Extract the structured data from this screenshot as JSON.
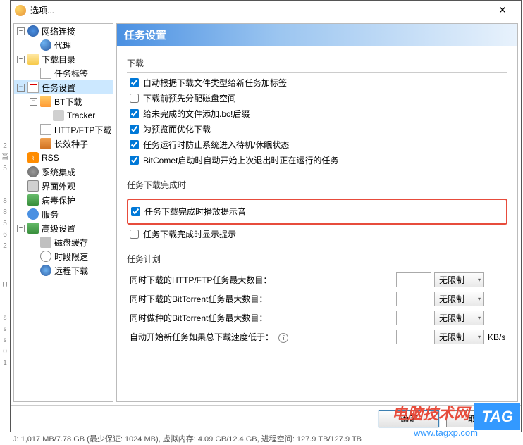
{
  "window": {
    "title": "选项..."
  },
  "sidebar": {
    "items": [
      {
        "label": "网络连接"
      },
      {
        "label": "代理"
      },
      {
        "label": "下载目录"
      },
      {
        "label": "任务标签"
      },
      {
        "label": "任务设置"
      },
      {
        "label": "BT下载"
      },
      {
        "label": "Tracker"
      },
      {
        "label": "HTTP/FTP下载"
      },
      {
        "label": "长效种子"
      },
      {
        "label": "RSS"
      },
      {
        "label": "系统集成"
      },
      {
        "label": "界面外观"
      },
      {
        "label": "病毒保护"
      },
      {
        "label": "服务"
      },
      {
        "label": "高级设置"
      },
      {
        "label": "磁盘缓存"
      },
      {
        "label": "时段限速"
      },
      {
        "label": "远程下载"
      }
    ]
  },
  "panel": {
    "title": "任务设置",
    "group_download": "下载",
    "chk_auto_tag": "自动根据下载文件类型给新任务加标签",
    "chk_prealloc": "下载前预先分配磁盘空间",
    "chk_bc_suffix": "给未完成的文件添加.bc!后缀",
    "chk_preview": "为预览而优化下载",
    "chk_prevent_sleep": "任务运行时防止系统进入待机/休眠状态",
    "chk_resume_on_start": "BitComet启动时自动开始上次退出时正在运行的任务",
    "group_complete": "任务下载完成时",
    "chk_play_sound": "任务下载完成时播放提示音",
    "chk_show_tip": "任务下载完成时显示提示",
    "group_plan": "任务计划",
    "plan_http_max": "同时下载的HTTP/FTP任务最大数目：",
    "plan_bt_max": "同时下载的BitTorrent任务最大数目：",
    "plan_seed_max": "同时做种的BitTorrent任务最大数目：",
    "plan_auto_start": "自动开始新任务如果总下载速度低于：",
    "dropdown_unlimited": "无限制",
    "unit_kbs": "KB/s"
  },
  "buttons": {
    "ok": "确定",
    "cancel": "取消"
  },
  "watermark": {
    "line1": "电脑技术网",
    "line2": "www.tagxp.com",
    "tag": "TAG"
  },
  "statusbar": "J: 1,017 MB/7.78 GB (最少保证: 1024 MB), 虚拟内存: 4.09 GB/12.4 GB, 进程空间: 127.9 TB/127.9 TB",
  "left_gutter": [
    "2",
    "当",
    "5",
    "8",
    "8",
    "5",
    "6",
    "2",
    "",
    "U",
    "",
    "s",
    "s",
    "s",
    "0",
    "1"
  ]
}
